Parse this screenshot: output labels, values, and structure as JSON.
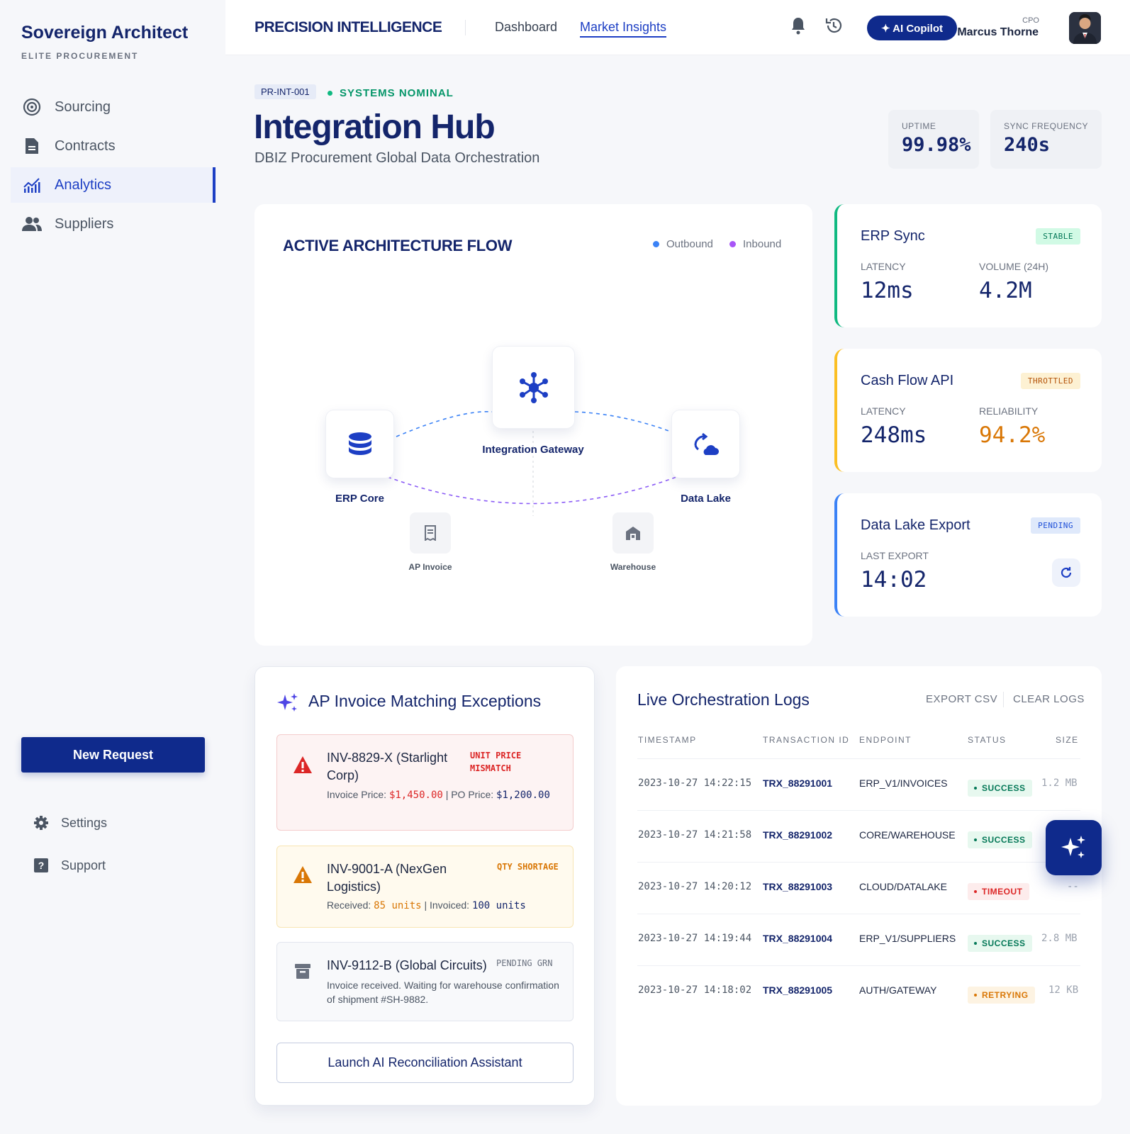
{
  "sidebar": {
    "brand_title": "Sovereign Architect",
    "brand_sub": "ELITE PROCUREMENT",
    "items": [
      {
        "label": "Sourcing",
        "icon": "target-icon"
      },
      {
        "label": "Contracts",
        "icon": "document-icon"
      },
      {
        "label": "Analytics",
        "icon": "analytics-icon",
        "active": true
      },
      {
        "label": "Suppliers",
        "icon": "users-icon"
      }
    ],
    "new_request": "New Request",
    "settings": "Settings",
    "support": "Support"
  },
  "topbar": {
    "brand": "PRECISION INTELLIGENCE",
    "nav_dashboard": "Dashboard",
    "nav_insights": "Market Insights",
    "copilot": "✦ AI Copilot",
    "user_role": "CPO",
    "user_name": "Marcus Thorne"
  },
  "header": {
    "tag": "PR-INT-001",
    "status": "SYSTEMS NOMINAL",
    "title": "Integration Hub",
    "subtitle": "DBIZ Procurement Global Data Orchestration",
    "uptime_label": "UPTIME",
    "uptime_value": "99.98%",
    "sync_label": "SYNC FREQUENCY",
    "sync_value": "240s"
  },
  "architecture": {
    "title": "ACTIVE ARCHITECTURE FLOW",
    "legend_outbound": "Outbound",
    "legend_inbound": "Inbound",
    "gateway": "Integration Gateway",
    "erp": "ERP Core",
    "lake": "Data Lake",
    "ap": "AP Invoice",
    "warehouse": "Warehouse"
  },
  "status_cards": {
    "erp": {
      "name": "ERP Sync",
      "badge": "STABLE",
      "l1": "LATENCY",
      "v1": "12ms",
      "l2": "VOLUME (24H)",
      "v2": "4.2M"
    },
    "cash": {
      "name": "Cash Flow API",
      "badge": "THROTTLED",
      "l1": "LATENCY",
      "v1": "248ms",
      "l2": "RELIABILITY",
      "v2": "94.2%"
    },
    "lake": {
      "name": "Data Lake Export",
      "badge": "PENDING",
      "l1": "LAST EXPORT",
      "v1": "14:02"
    }
  },
  "exceptions": {
    "title": "AP Invoice Matching Exceptions",
    "items": [
      {
        "title": "INV-8829-X (Starlight Corp)",
        "tag": "UNIT PRICE MISMATCH",
        "d1": "Invoice Price:",
        "d2": "$1,450.00",
        "d3": "| PO Price:",
        "d4": "$1,200.00"
      },
      {
        "title": "INV-9001-A (NexGen Logistics)",
        "tag": "QTY SHORTAGE",
        "d1": "Received:",
        "d2": "85 units",
        "d3": "| Invoiced:",
        "d4": "100 units"
      },
      {
        "title": "INV-9112-B (Global Circuits)",
        "tag": "PENDING GRN",
        "d1": "Invoice received. Waiting for warehouse confirmation of shipment #SH-9882."
      }
    ],
    "launch": "Launch AI Reconciliation Assistant"
  },
  "logs": {
    "title": "Live Orchestration Logs",
    "export": "EXPORT CSV",
    "clear": "CLEAR LOGS",
    "headers": [
      "TIMESTAMP",
      "TRANSACTION ID",
      "ENDPOINT",
      "STATUS",
      "SIZE"
    ],
    "rows": [
      {
        "ts": "2023-10-27 14:22:15",
        "id": "TRX_88291001",
        "ep": "ERP_V1/INVOICES",
        "status": "SUCCESS",
        "size": "1.2 MB"
      },
      {
        "ts": "2023-10-27 14:21:58",
        "id": "TRX_88291002",
        "ep": "CORE/WAREHOUSE",
        "status": "SUCCESS",
        "size": ""
      },
      {
        "ts": "2023-10-27 14:20:12",
        "id": "TRX_88291003",
        "ep": "CLOUD/DATALAKE",
        "status": "TIMEOUT",
        "size": "--"
      },
      {
        "ts": "2023-10-27 14:19:44",
        "id": "TRX_88291004",
        "ep": "ERP_V1/SUPPLIERS",
        "status": "SUCCESS",
        "size": "2.8 MB"
      },
      {
        "ts": "2023-10-27 14:18:02",
        "id": "TRX_88291005",
        "ep": "AUTH/GATEWAY",
        "status": "RETRYING",
        "size": "12 KB"
      }
    ]
  },
  "colors": {
    "primary": "#0f2a8c",
    "accent": "#1d3fc4",
    "success": "#059669",
    "warning": "#d97706",
    "danger": "#dc2626"
  }
}
